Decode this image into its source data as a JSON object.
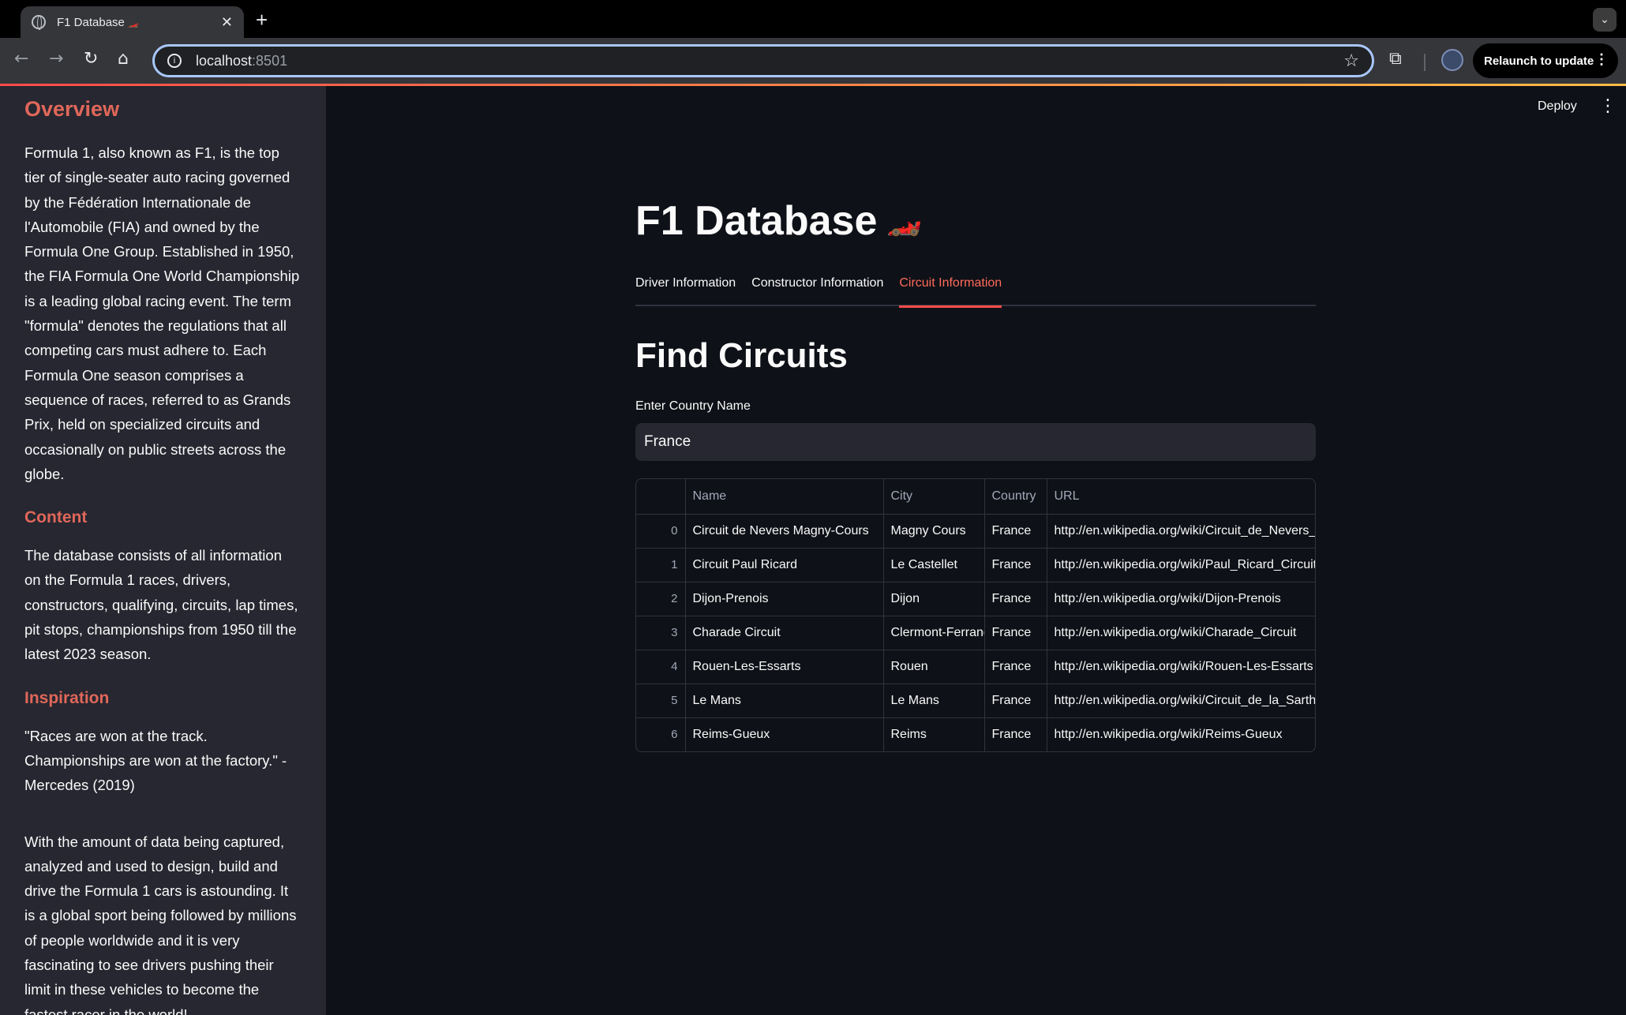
{
  "browser": {
    "tab_title": "F1 Database",
    "tab_emoji": "🏎️",
    "url_host": "localhost",
    "url_port": ":8501",
    "relaunch_label": "Relaunch to update"
  },
  "sidebar": {
    "overview_title": "Overview",
    "overview_text": "Formula 1, also known as F1, is the top tier of single-seater auto racing governed by the Fédération Internationale de l'Automobile (FIA) and owned by the Formula One Group. Established in 1950, the FIA Formula One World Championship is a leading global racing event. The term \"formula\" denotes the regulations that all competing cars must adhere to. Each Formula One season comprises a sequence of races, referred to as Grands Prix, held on specialized circuits and occasionally on public streets across the globe.",
    "content_title": "Content",
    "content_text": "The database consists of all information on the Formula 1 races, drivers, constructors, qualifying, circuits, lap times, pit stops, championships from 1950 till the latest 2023 season.",
    "inspiration_title": "Inspiration",
    "inspiration_quote": "\"Races are won at the track. Championships are won at the factory.\" - Mercedes (2019)",
    "inspiration_text": "With the amount of data being captured, analyzed and used to design, build and drive the Formula 1 cars is astounding. It is a global sport being followed by millions of people worldwide and it is very fascinating to see drivers pushing their limit in these vehicles to become the fastest racer in the world!"
  },
  "header": {
    "deploy_label": "Deploy"
  },
  "main": {
    "title": "F1 Database",
    "title_emoji": "🏎️",
    "tabs": [
      {
        "label": "Driver Information"
      },
      {
        "label": "Constructor Information"
      },
      {
        "label": "Circuit Information"
      }
    ],
    "section_title": "Find Circuits",
    "input_label": "Enter Country Name",
    "input_value": "France",
    "table": {
      "columns": [
        "",
        "Name",
        "City",
        "Country",
        "URL"
      ],
      "rows": [
        [
          "0",
          "Circuit de Nevers Magny-Cours",
          "Magny Cours",
          "France",
          "http://en.wikipedia.org/wiki/Circuit_de_Nevers_Magny-Cours"
        ],
        [
          "1",
          "Circuit Paul Ricard",
          "Le Castellet",
          "France",
          "http://en.wikipedia.org/wiki/Paul_Ricard_Circuit"
        ],
        [
          "2",
          "Dijon-Prenois",
          "Dijon",
          "France",
          "http://en.wikipedia.org/wiki/Dijon-Prenois"
        ],
        [
          "3",
          "Charade Circuit",
          "Clermont-Ferrand",
          "France",
          "http://en.wikipedia.org/wiki/Charade_Circuit"
        ],
        [
          "4",
          "Rouen-Les-Essarts",
          "Rouen",
          "France",
          "http://en.wikipedia.org/wiki/Rouen-Les-Essarts"
        ],
        [
          "5",
          "Le Mans",
          "Le Mans",
          "France",
          "http://en.wikipedia.org/wiki/Circuit_de_la_Sarthe"
        ],
        [
          "6",
          "Reims-Gueux",
          "Reims",
          "France",
          "http://en.wikipedia.org/wiki/Reims-Gueux"
        ]
      ]
    }
  }
}
